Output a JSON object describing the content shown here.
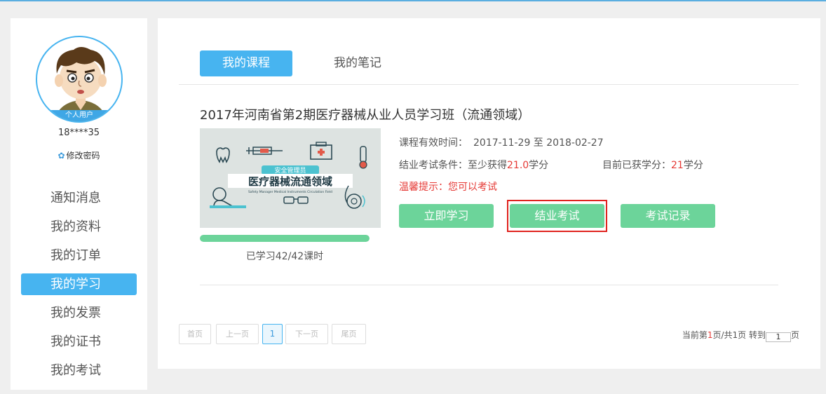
{
  "user": {
    "avatar_badge": "个人用户",
    "username": "18****35",
    "change_password": "修改密码"
  },
  "sidebar": {
    "items": [
      {
        "label": "通知消息"
      },
      {
        "label": "我的资料"
      },
      {
        "label": "我的订单"
      },
      {
        "label": "我的学习",
        "active": true
      },
      {
        "label": "我的发票"
      },
      {
        "label": "我的证书"
      },
      {
        "label": "我的考试"
      }
    ]
  },
  "tabs": {
    "course": "我的课程",
    "notes": "我的笔记"
  },
  "course": {
    "title": "2017年河南省第2期医疗器械从业人员学习班（流通领域）",
    "thumb": {
      "badge": "安全管理员",
      "title": "医疗器械流通领域",
      "subtitle": "Safety Manager Medical Instruments Circulation Field"
    },
    "progress_fraction": 1.0,
    "progress_text": "已学习42/42课时",
    "valid_label": "课程有效时间：",
    "valid_value": "2017-11-29 至 2018-02-27",
    "cond_prefix": "结业考试条件：至少获得",
    "cond_value": "21.0",
    "cond_suffix": "学分",
    "earned_prefix": "目前已获学分：",
    "earned_value": "21",
    "earned_suffix": "学分",
    "tip": "温馨提示：您可以考试",
    "btn_study": "立即学习",
    "btn_exam": "结业考试",
    "btn_record": "考试记录"
  },
  "pager": {
    "first": "首页",
    "prev": "上一页",
    "current": "1",
    "next": "下一页",
    "last": "尾页",
    "info_prefix": "当前第",
    "info_page": "1",
    "info_mid": "页/共",
    "info_total": "1",
    "info_suffix": "页 转到",
    "jump_value": "1",
    "jump_suffix": "页"
  },
  "colors": {
    "accent": "#47b4f0",
    "green_button": "#6cd49a",
    "highlight_red": "#e0231f"
  }
}
